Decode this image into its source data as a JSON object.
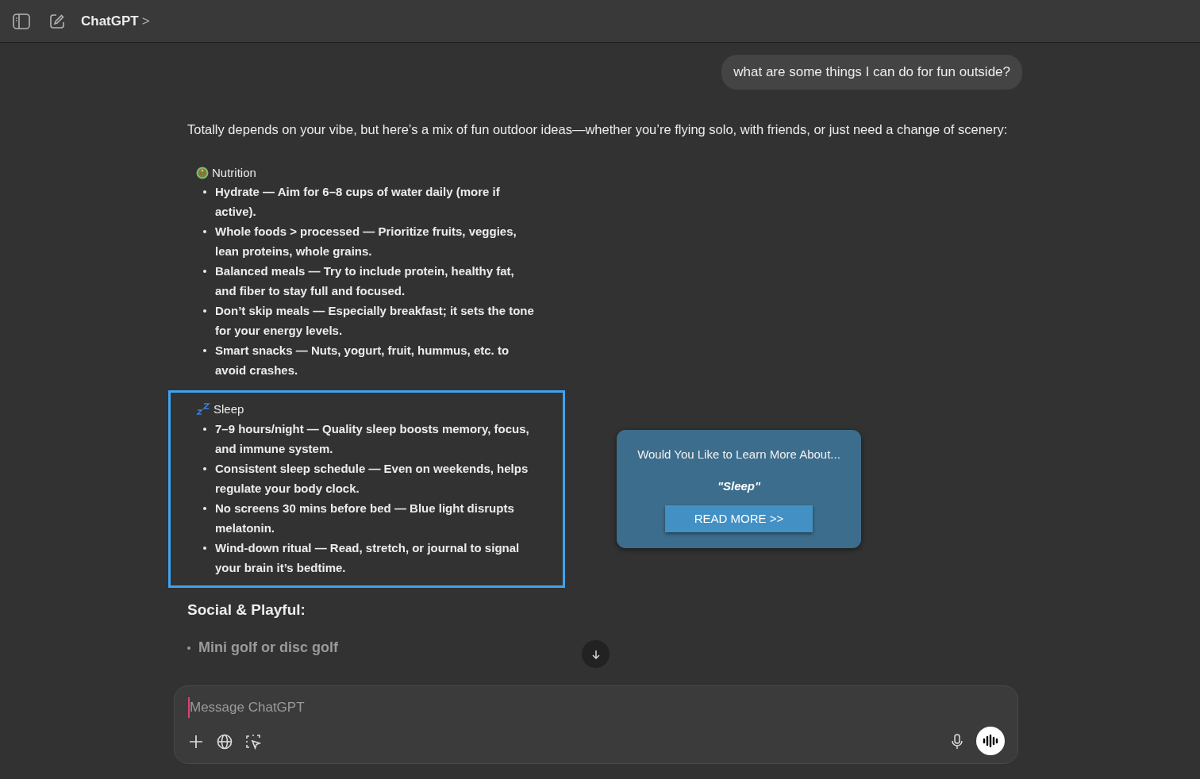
{
  "header": {
    "title": "ChatGPT",
    "chevron": ">"
  },
  "user_message": "what are some things I can do for fun outside?",
  "intro": "Totally depends on your vibe, but here’s a mix of fun outdoor ideas—whether you’re flying solo, with friends, or just need a change of scenery:",
  "sections": [
    {
      "kind": "salad",
      "heading": "Nutrition",
      "highlighted": false,
      "items": [
        "Hydrate — Aim for 6–8 cups of water daily (more if active).",
        "Whole foods > processed — Prioritize fruits, veggies, lean proteins, whole grains.",
        "Balanced meals — Try to include protein, healthy fat, and fiber to stay full and focused.",
        "Don’t skip meals — Especially breakfast; it sets the tone for your energy levels.",
        "Smart snacks — Nuts, yogurt, fruit, hummus, etc. to avoid crashes."
      ]
    },
    {
      "kind": "sleep",
      "heading": "Sleep",
      "highlighted": true,
      "items": [
        "7–9 hours/night — Quality sleep boosts memory, focus, and immune system.",
        "Consistent sleep schedule — Even on weekends, helps regulate your body clock.",
        "No screens 30 mins before bed — Blue light disrupts melatonin.",
        "Wind-down ritual — Read, stretch, or journal to signal your brain it’s bedtime."
      ]
    }
  ],
  "promo_card": {
    "prompt": "Would You Like to Learn More About...",
    "topic": "\"Sleep\"",
    "button": "READ MORE >>"
  },
  "next_heading": "Social & Playful:",
  "faded_item": "Mini golf or disc golf",
  "composer": {
    "placeholder": "Message ChatGPT"
  }
}
